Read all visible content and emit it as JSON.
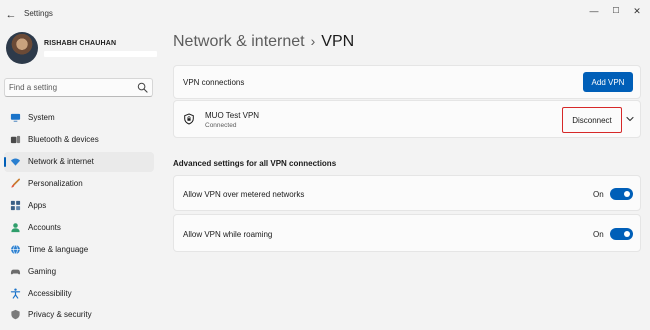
{
  "window": {
    "title": "Settings",
    "controls": {
      "minimize": "—",
      "maximize": "☐",
      "close": "✕"
    }
  },
  "profile": {
    "name": "RISHABH CHAUHAN"
  },
  "search": {
    "placeholder": "Find a setting",
    "value": ""
  },
  "sidebar": {
    "items": [
      {
        "label": "System",
        "icon": "monitor-icon",
        "selected": false
      },
      {
        "label": "Bluetooth & devices",
        "icon": "bluetooth-devices-icon",
        "selected": false
      },
      {
        "label": "Network & internet",
        "icon": "wifi-icon",
        "selected": true
      },
      {
        "label": "Personalization",
        "icon": "brush-icon",
        "selected": false
      },
      {
        "label": "Apps",
        "icon": "apps-icon",
        "selected": false
      },
      {
        "label": "Accounts",
        "icon": "person-icon",
        "selected": false
      },
      {
        "label": "Time & language",
        "icon": "globe-clock-icon",
        "selected": false
      },
      {
        "label": "Gaming",
        "icon": "gamepad-icon",
        "selected": false
      },
      {
        "label": "Accessibility",
        "icon": "accessibility-icon",
        "selected": false
      },
      {
        "label": "Privacy & security",
        "icon": "shield-icon",
        "selected": false
      }
    ]
  },
  "breadcrumb": {
    "parent": "Network & internet",
    "separator": "›",
    "current": "VPN"
  },
  "vpn_connections": {
    "label": "VPN connections",
    "add_button": "Add VPN"
  },
  "vpn_item": {
    "name": "MUO Test VPN",
    "status": "Connected",
    "disconnect_button": "Disconnect"
  },
  "advanced": {
    "title": "Advanced settings for all VPN connections",
    "settings": [
      {
        "label": "Allow VPN over metered networks",
        "state": "On",
        "enabled": true
      },
      {
        "label": "Allow VPN while roaming",
        "state": "On",
        "enabled": true
      }
    ]
  },
  "colors": {
    "accent": "#005fb8",
    "highlight_border": "#d62828",
    "background": "#f3f3f3",
    "card": "#fbfbfb"
  }
}
